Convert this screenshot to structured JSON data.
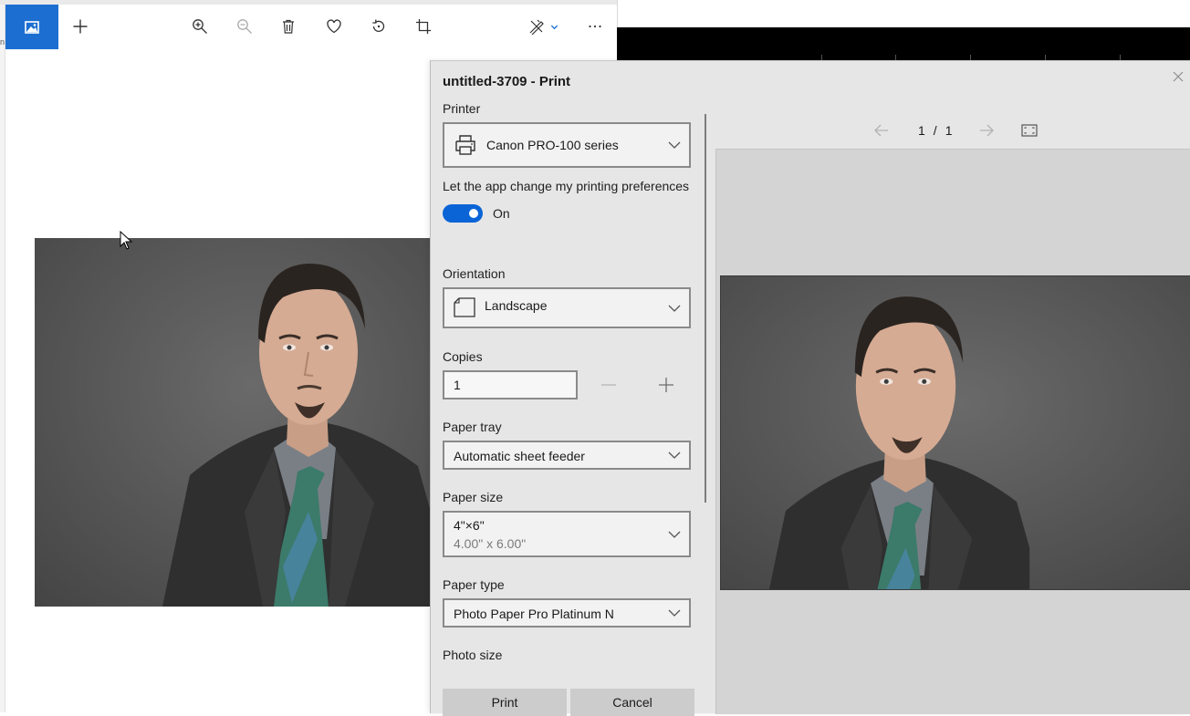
{
  "photos_app": {
    "toolbar": {
      "home": "image-icon",
      "add": "plus-icon",
      "zoom_in": "zoom-in-icon",
      "zoom_out": "zoom-out-icon",
      "delete": "trash-icon",
      "favorite": "heart-icon",
      "rotate": "rotate-icon",
      "crop": "crop-icon",
      "edit": "edit-draw-icon",
      "more": "more-icon"
    },
    "accent": "#1c6fd1",
    "left_edge_char": "n"
  },
  "print_dialog": {
    "title": "untitled-3709 - Print",
    "printer_label": "Printer",
    "printer_value": "Canon PRO-100 series",
    "prefs_label": "Let the app change my printing preferences",
    "prefs_toggle": "On",
    "orientation_label": "Orientation",
    "orientation_value": "Landscape",
    "copies_label": "Copies",
    "copies_value": "1",
    "paper_tray_label": "Paper tray",
    "paper_tray_value": "Automatic sheet feeder",
    "paper_size_label": "Paper size",
    "paper_size_value": "4\"×6\"",
    "paper_size_sub": "4.00\" x 6.00\"",
    "paper_type_label": "Paper type",
    "paper_type_value": "Photo Paper Pro Platinum N",
    "photo_size_label": "Photo size",
    "print_button": "Print",
    "cancel_button": "Cancel",
    "page_current": "1",
    "page_sep": "/",
    "page_total": "1",
    "toggle_color": "#0a64d6"
  }
}
